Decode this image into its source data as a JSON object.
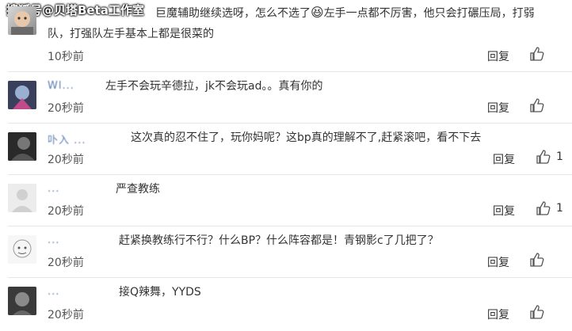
{
  "watermark": "搜狐号@贝塔Beta工作室",
  "reply_label": "回复",
  "comments": [
    {
      "name": "",
      "text_line1": "巨魔辅助继续选呀，怎么不选了",
      "emoji": "😆",
      "text_line1b": "左手一点都不厉害，他只会打碾压局，打弱",
      "text_line2": "队，打强队左手基本上都是很菜的",
      "time": "10秒前",
      "likes": ""
    },
    {
      "name": "Wl...",
      "text": "左手不会玩辛德拉，jk不会玩ad。。真有你的",
      "time": "20秒前",
      "likes": ""
    },
    {
      "name": "卟入 ...",
      "text": "这次真的忍不住了，玩你妈呢？这bp真的理解不了,赶紧滚吧，看不下去",
      "time": "20秒前",
      "likes": "1"
    },
    {
      "name": "...",
      "text": "严查教练",
      "time": "20秒前",
      "likes": "1"
    },
    {
      "name": "...",
      "text": "赶紧换教练行不行？什么BP？什么阵容都是！青钢影c了几把了？",
      "time": "20秒前",
      "likes": ""
    },
    {
      "name": "...",
      "text": "接Q辣舞，YYDS",
      "time": "20秒前",
      "likes": ""
    }
  ]
}
